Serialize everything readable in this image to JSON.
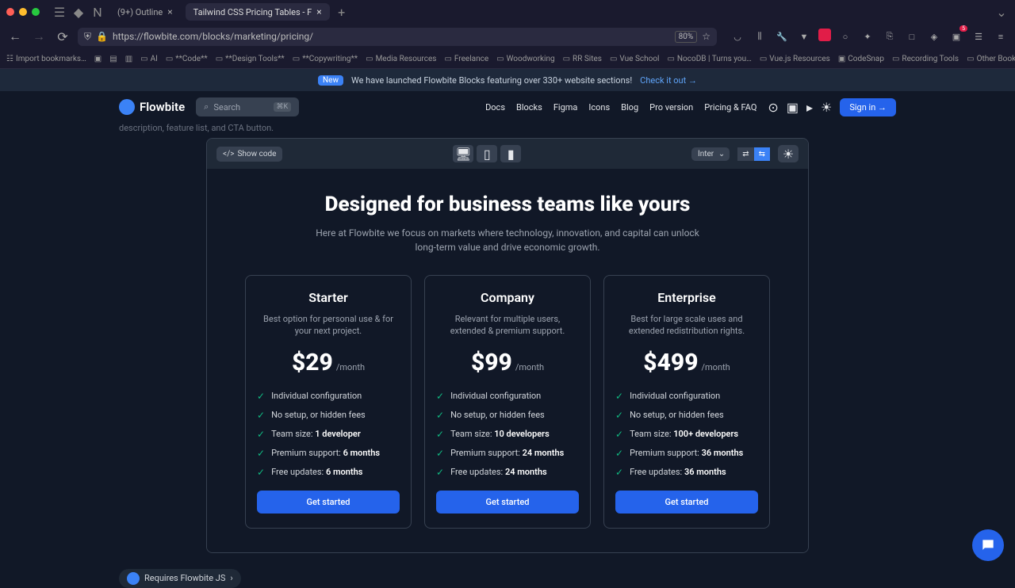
{
  "browser": {
    "tabs": [
      {
        "label": "(9+) Outline",
        "active": false
      },
      {
        "label": "Tailwind CSS Pricing Tables - F",
        "active": true
      }
    ],
    "url": "https://flowbite.com/blocks/marketing/pricing/",
    "zoom": "80%",
    "bookmarks": [
      "Import bookmarks…",
      "",
      "",
      "",
      "AI",
      "**Code**",
      "**Design Tools**",
      "**Copywriting**",
      "Media Resources",
      "Freelance",
      "Woodworking",
      "RR Sites",
      "Vue School",
      "NocoDB | Turns you…",
      "Vue.js Resources",
      "CodeSnap",
      "Recording Tools"
    ],
    "other_bookmarks": "Other Bookmarks",
    "ext_badge": "5"
  },
  "announcement": {
    "badge": "New",
    "text": "We have launched Flowbite Blocks featuring over 330+ website sections!",
    "link": "Check it out →"
  },
  "nav": {
    "brand": "Flowbite",
    "search_placeholder": "Search",
    "search_kbd": "⌘K",
    "links": [
      "Docs",
      "Blocks",
      "Figma",
      "Icons",
      "Blog",
      "Pro version",
      "Pricing & FAQ"
    ],
    "signin": "Sign in →"
  },
  "desc_line": "description, feature list, and CTA button.",
  "toolbar": {
    "show_code": "Show code",
    "font": "Inter"
  },
  "pricing": {
    "title": "Designed for business teams like yours",
    "subtitle": "Here at Flowbite we focus on markets where technology, innovation, and capital can unlock long-term value and drive economic growth.",
    "plans": [
      {
        "name": "Starter",
        "desc": "Best option for personal use & for your next project.",
        "price": "$29",
        "period": "/month",
        "features": [
          {
            "text": "Individual configuration",
            "bold": ""
          },
          {
            "text": "No setup, or hidden fees",
            "bold": ""
          },
          {
            "text": "Team size: ",
            "bold": "1 developer"
          },
          {
            "text": "Premium support: ",
            "bold": "6 months"
          },
          {
            "text": "Free updates: ",
            "bold": "6 months"
          }
        ],
        "cta": "Get started"
      },
      {
        "name": "Company",
        "desc": "Relevant for multiple users, extended & premium support.",
        "price": "$99",
        "period": "/month",
        "features": [
          {
            "text": "Individual configuration",
            "bold": ""
          },
          {
            "text": "No setup, or hidden fees",
            "bold": ""
          },
          {
            "text": "Team size: ",
            "bold": "10 developers"
          },
          {
            "text": "Premium support: ",
            "bold": "24 months"
          },
          {
            "text": "Free updates: ",
            "bold": "24 months"
          }
        ],
        "cta": "Get started"
      },
      {
        "name": "Enterprise",
        "desc": "Best for large scale uses and extended redistribution rights.",
        "price": "$499",
        "period": "/month",
        "features": [
          {
            "text": "Individual configuration",
            "bold": ""
          },
          {
            "text": "No setup, or hidden fees",
            "bold": ""
          },
          {
            "text": "Team size: ",
            "bold": "100+ developers"
          },
          {
            "text": "Premium support: ",
            "bold": "36 months"
          },
          {
            "text": "Free updates: ",
            "bold": "36 months"
          }
        ],
        "cta": "Get started"
      }
    ]
  },
  "requires_badge": "Requires Flowbite JS"
}
